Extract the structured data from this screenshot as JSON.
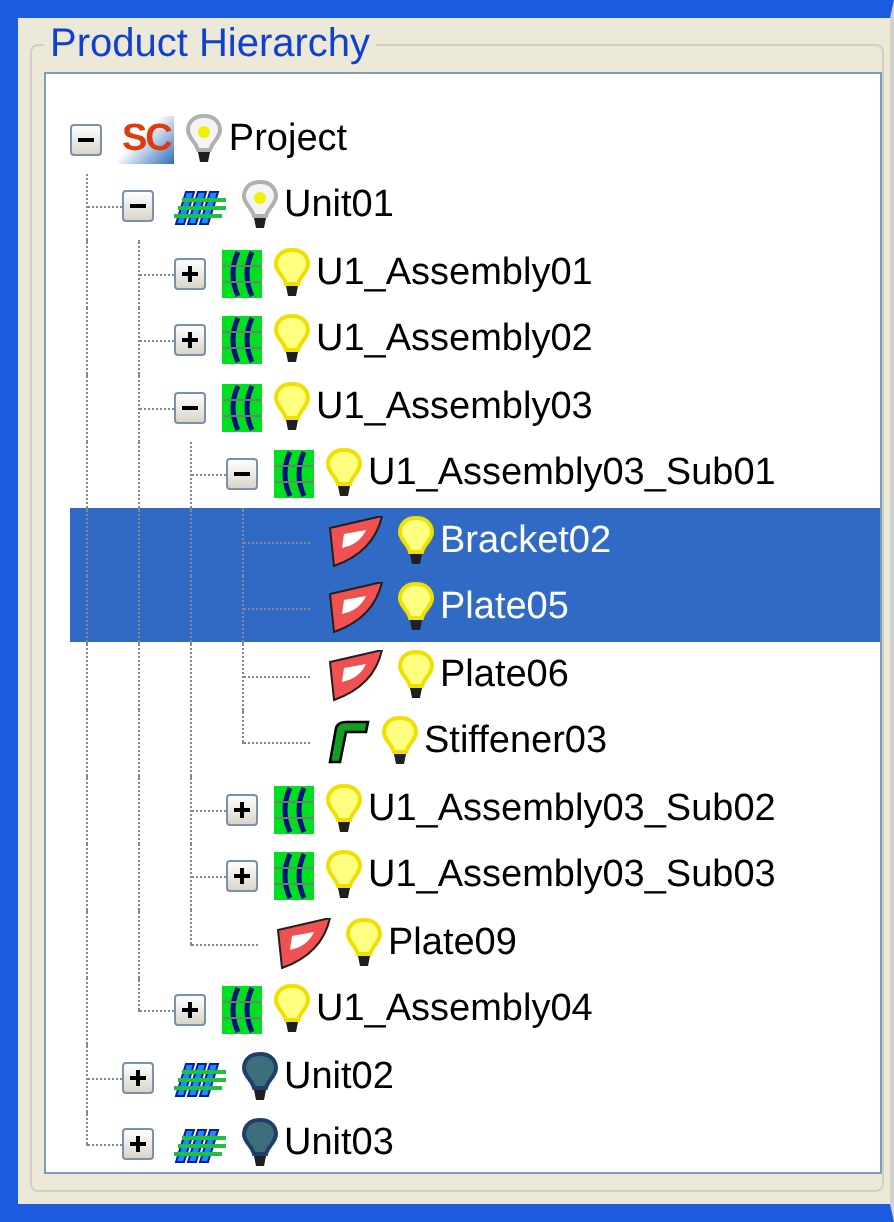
{
  "panel": {
    "title": "Product Hierarchy"
  },
  "tree": [
    {
      "label": "Project",
      "kind": "project",
      "logo": "SC",
      "lit": true,
      "mixed": true,
      "expanded": true,
      "selected": false,
      "children": [
        {
          "label": "Unit01",
          "kind": "unit",
          "lit": true,
          "mixed": true,
          "expanded": true,
          "selected": false,
          "children": [
            {
              "label": "U1_Assembly01",
              "kind": "assembly",
              "lit": true,
              "mixed": false,
              "expanded": false,
              "selected": false
            },
            {
              "label": "U1_Assembly02",
              "kind": "assembly",
              "lit": true,
              "mixed": false,
              "expanded": false,
              "selected": false
            },
            {
              "label": "U1_Assembly03",
              "kind": "assembly",
              "lit": true,
              "mixed": false,
              "expanded": true,
              "selected": false,
              "children": [
                {
                  "label": "U1_Assembly03_Sub01",
                  "kind": "assembly",
                  "lit": true,
                  "mixed": false,
                  "expanded": true,
                  "selected": false,
                  "children": [
                    {
                      "label": "Bracket02",
                      "kind": "plate",
                      "lit": true,
                      "mixed": false,
                      "selected": true
                    },
                    {
                      "label": "Plate05",
                      "kind": "plate",
                      "lit": true,
                      "mixed": false,
                      "selected": true
                    },
                    {
                      "label": "Plate06",
                      "kind": "plate",
                      "lit": true,
                      "mixed": false,
                      "selected": false
                    },
                    {
                      "label": "Stiffener03",
                      "kind": "stiffener",
                      "lit": true,
                      "mixed": false,
                      "selected": false
                    }
                  ]
                },
                {
                  "label": "U1_Assembly03_Sub02",
                  "kind": "assembly",
                  "lit": true,
                  "mixed": false,
                  "expanded": false,
                  "selected": false
                },
                {
                  "label": "U1_Assembly03_Sub03",
                  "kind": "assembly",
                  "lit": true,
                  "mixed": false,
                  "expanded": false,
                  "selected": false
                },
                {
                  "label": "Plate09",
                  "kind": "plate",
                  "lit": true,
                  "mixed": false,
                  "selected": false
                }
              ]
            },
            {
              "label": "U1_Assembly04",
              "kind": "assembly",
              "lit": true,
              "mixed": false,
              "expanded": false,
              "selected": false
            }
          ]
        },
        {
          "label": "Unit02",
          "kind": "unit",
          "lit": false,
          "mixed": false,
          "expanded": false,
          "selected": false
        },
        {
          "label": "Unit03",
          "kind": "unit",
          "lit": false,
          "mixed": false,
          "expanded": false,
          "selected": false
        }
      ]
    }
  ]
}
